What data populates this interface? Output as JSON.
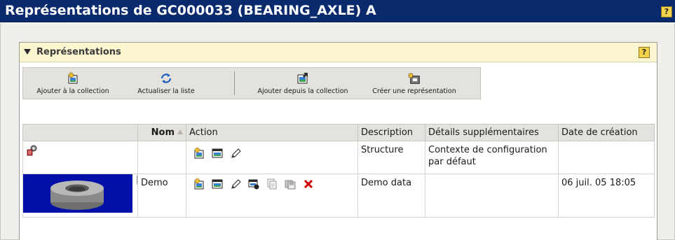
{
  "page": {
    "title": "Représentations de GC000033 (BEARING_AXLE) A",
    "help_label": "?"
  },
  "panel": {
    "title": "Représentations",
    "help_label": "?"
  },
  "toolbar": {
    "buttons": [
      {
        "label": "Ajouter à la collection",
        "icon": "add-to-collection-icon"
      },
      {
        "label": "Actualiser la liste",
        "icon": "refresh-icon"
      },
      {
        "label": "Ajouter depuis la collection",
        "icon": "add-from-collection-icon"
      },
      {
        "label": "Créer une représentation",
        "icon": "create-representation-icon"
      }
    ]
  },
  "table": {
    "columns": [
      "",
      "Nom",
      "Action",
      "Description",
      "Détails supplémentaires",
      "Date de création"
    ],
    "sorted_column": "Nom",
    "sort_direction": "ascending",
    "rows": [
      {
        "type_icon": "configuration-structure-icon",
        "name": "",
        "actions": [
          "add-to-collection-icon",
          "view-icon",
          "edit-icon"
        ],
        "description": "Structure",
        "details": "Contexte de configuration par défaut",
        "date": ""
      },
      {
        "type_icon": "thumbnail-image",
        "name": "Demo",
        "actions": [
          "add-to-collection-icon",
          "view-icon",
          "edit-icon",
          "set-default-icon",
          "copy-icon",
          "save-icon",
          "delete-icon"
        ],
        "description": "Demo data",
        "details": "",
        "date": "06 juil. 05 18:05"
      }
    ]
  },
  "colors": {
    "title_bar": "#0a2a6e",
    "panel_header": "#fbf6cf",
    "toolbar": "#e4e2dc",
    "thumbnail_bg": "#0010a8",
    "delete": "#cc0000",
    "help_button": "#f1d24a"
  }
}
